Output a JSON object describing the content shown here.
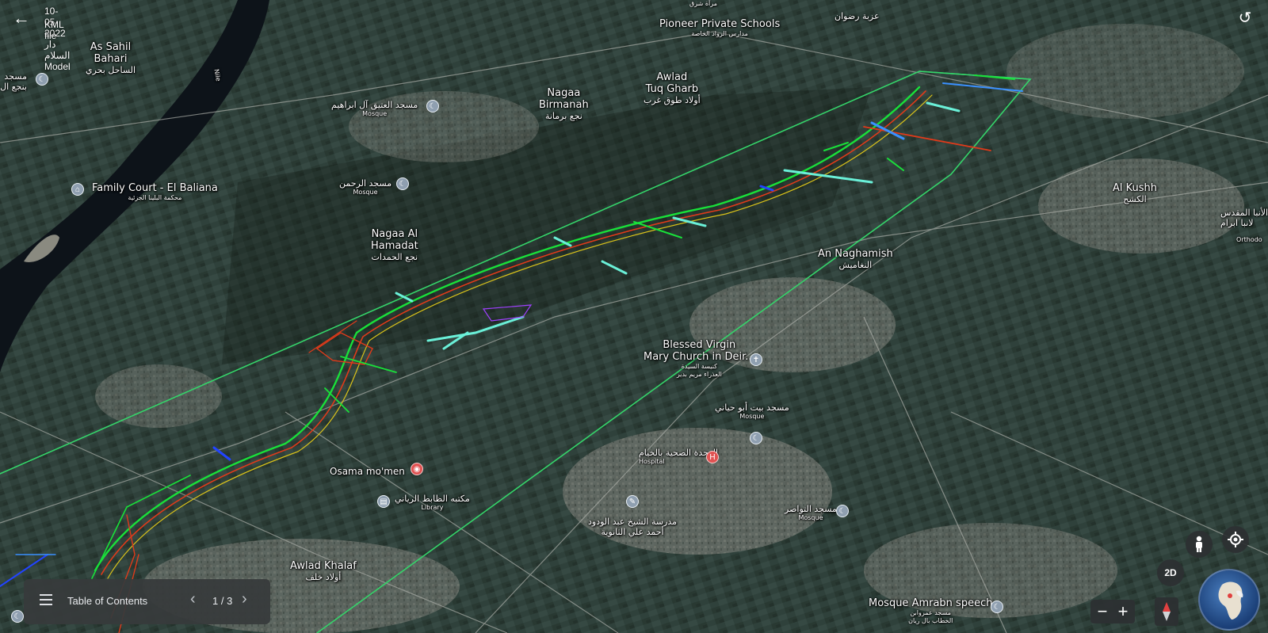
{
  "header": {
    "title": "10-05-2022 دار السلام Model",
    "subtitle": "KML file"
  },
  "places": {
    "as_sahil_en": "As Sahil\nBahari",
    "as_sahil_ar": "الساحل بحري",
    "masjid_left": "مسجد\nبنجع ال",
    "pioneer": "Pioneer Private Schools",
    "pioneer_ar": "مدارس الرواد الخاصة",
    "izba": "عزبة رضوان",
    "mirat": "مرآة شرق",
    "nagaa_birmanah": "Nagaa\nBirmanah",
    "nagaa_birmanah_ar": "نجع برمانة",
    "awlad_tuq": "Awlad\nTuq Gharb",
    "awlad_tuq_ar": "أولاد طوق غرب",
    "mosque_ibrahim_ar": "مسجد العتيق آل ابراهيم",
    "mosque_word": "Mosque",
    "family_court": "Family Court - El Baliana",
    "family_court_ar": "محكمة البلينا الجزئية",
    "mosque_rahman_ar": "مسجد الرحمن",
    "nagaa_hamadat": "Nagaa Al\nHamadat",
    "nagaa_hamadat_ar": "نجع الحمدات",
    "an_naghamish": "An Naghamish",
    "an_naghamish_ar": "النغاميش",
    "al_kushh": "Al Kushh",
    "al_kushh_ar": "الكشح",
    "right_ar": "الأنبا المقدس\nلانبا ابرام",
    "orthodo": "Orthodo",
    "blessed": "Blessed Virgin\nMary Church in Deir...",
    "blessed_ar": "كنيسة السيدة\nالعذراء مريم بدير",
    "masjid_bayt_ar": "مسجد بيت أبو حياني",
    "hospital_ar": "الوحدة الصحية بالخيام",
    "hospital": "Hospital",
    "osama": "Osama mo'men",
    "library_ar": "مكتبه الظابط الرياني",
    "library": "Library",
    "school_ar": "مدرسة الشيخ عبد الودود\nأحمد علي الثانوية",
    "masjid_tawasir_ar": "مسجد التواصر",
    "awlad_khalaf": "Awlad Khalaf",
    "awlad_khalaf_ar": "أولاد خلف",
    "mosque_amrabn": "Mosque Amrabn speech",
    "mosque_amrabn_ar": "مسجد عمروابن\nالخطاب بال ريان",
    "nile": "Nile"
  },
  "toc": {
    "label": "Table of Contents",
    "page": "1 / 3"
  },
  "controls": {
    "mode": "2D",
    "zoom_out": "−",
    "zoom_in": "+"
  },
  "icons": [
    "back-arrow-icon",
    "reset-view-icon",
    "menu-icon",
    "chevron-left-icon",
    "chevron-right-icon",
    "pegman-icon",
    "my-location-icon",
    "compass-icon",
    "globe-icon"
  ]
}
